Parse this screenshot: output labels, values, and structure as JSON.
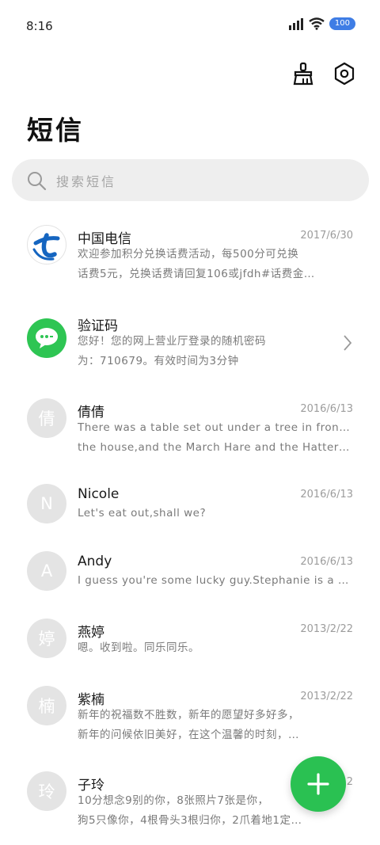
{
  "status_bar": {
    "time": "8:16",
    "battery": "100"
  },
  "header": {
    "title": "短信"
  },
  "search": {
    "placeholder": "搜索短信"
  },
  "messages": [
    {
      "avatar_type": "telecom",
      "name": "中国电信",
      "date": "2017/6/30",
      "preview": [
        "欢迎参加积分兑换话费活动，每500分可兑换",
        "话费5元，兑换话费请回复106或jfdh#话费金…"
      ]
    },
    {
      "avatar_type": "wechat",
      "name": "验证码",
      "date": "",
      "preview": [
        "您好！您的网上营业厅登录的随机密码",
        "为：710679。有效时间为3分钟"
      ]
    },
    {
      "avatar_type": "letter",
      "avatar_letter": "倩",
      "name": "倩倩",
      "date": "2016/6/13",
      "preview": [
        "There was a table set out under a tree in front of",
        "the house,and the March Hare and the Hatter wer…"
      ]
    },
    {
      "avatar_type": "letter",
      "avatar_letter": "N",
      "name": "Nicole",
      "date": "2016/6/13",
      "preview": [
        "Let's eat out,shall we?"
      ]
    },
    {
      "avatar_type": "letter",
      "avatar_letter": "A",
      "name": "Andy",
      "date": "2016/6/13",
      "preview": [
        "I guess you're some lucky guy.Stephanie is a nice girl."
      ]
    },
    {
      "avatar_type": "letter",
      "avatar_letter": "婷",
      "name": "燕婷",
      "date": "2013/2/22",
      "preview": [
        "嗯。收到啦。同乐同乐。"
      ]
    },
    {
      "avatar_type": "letter",
      "avatar_letter": "楠",
      "name": "紫楠",
      "date": "2013/2/22",
      "preview": [
        "新年的祝福数不胜数，新年的愿望好多好多，",
        "新年的问候依旧美好，在这个温馨的时刻，…"
      ]
    },
    {
      "avatar_type": "letter",
      "avatar_letter": "玲",
      "name": "子玲",
      "date": "2",
      "preview": [
        "10分想念9别的你，8张照片7张是你，",
        "狗5只像你，4根骨头3根归你，2爪着地1定…"
      ]
    }
  ],
  "colors": {
    "accent": "#2ac152",
    "battery": "#3f7de5",
    "telecom_blue": "#1565c0"
  },
  "icons": {
    "clean": "broom-icon",
    "settings": "gear-icon",
    "search": "search-icon",
    "new_message": "plus-icon"
  }
}
